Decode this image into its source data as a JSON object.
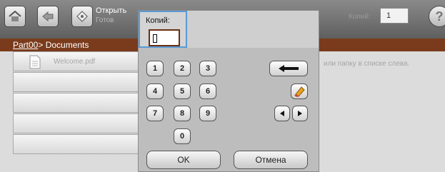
{
  "toolbar": {
    "open_label": "Открыть",
    "status": "Готов",
    "copies_label": "Копий:",
    "copies_value": "1",
    "help_label": "?"
  },
  "breadcrumb": {
    "link": "Part00",
    "rest": "> Documents"
  },
  "file_list": {
    "items": [
      {
        "label": "Welcome.pdf"
      },
      {
        "label": ""
      },
      {
        "label": ""
      },
      {
        "label": ""
      },
      {
        "label": ""
      }
    ]
  },
  "hint": "или папку в списке слева.",
  "keypad": {
    "title": "Копий:",
    "value": "",
    "keys": [
      "1",
      "2",
      "3",
      "4",
      "5",
      "6",
      "7",
      "8",
      "9",
      "0"
    ],
    "ok_label": "OK",
    "cancel_label": "Отмена"
  },
  "colors": {
    "accent": "#7a3b1c",
    "focus": "#5b9bd5"
  }
}
